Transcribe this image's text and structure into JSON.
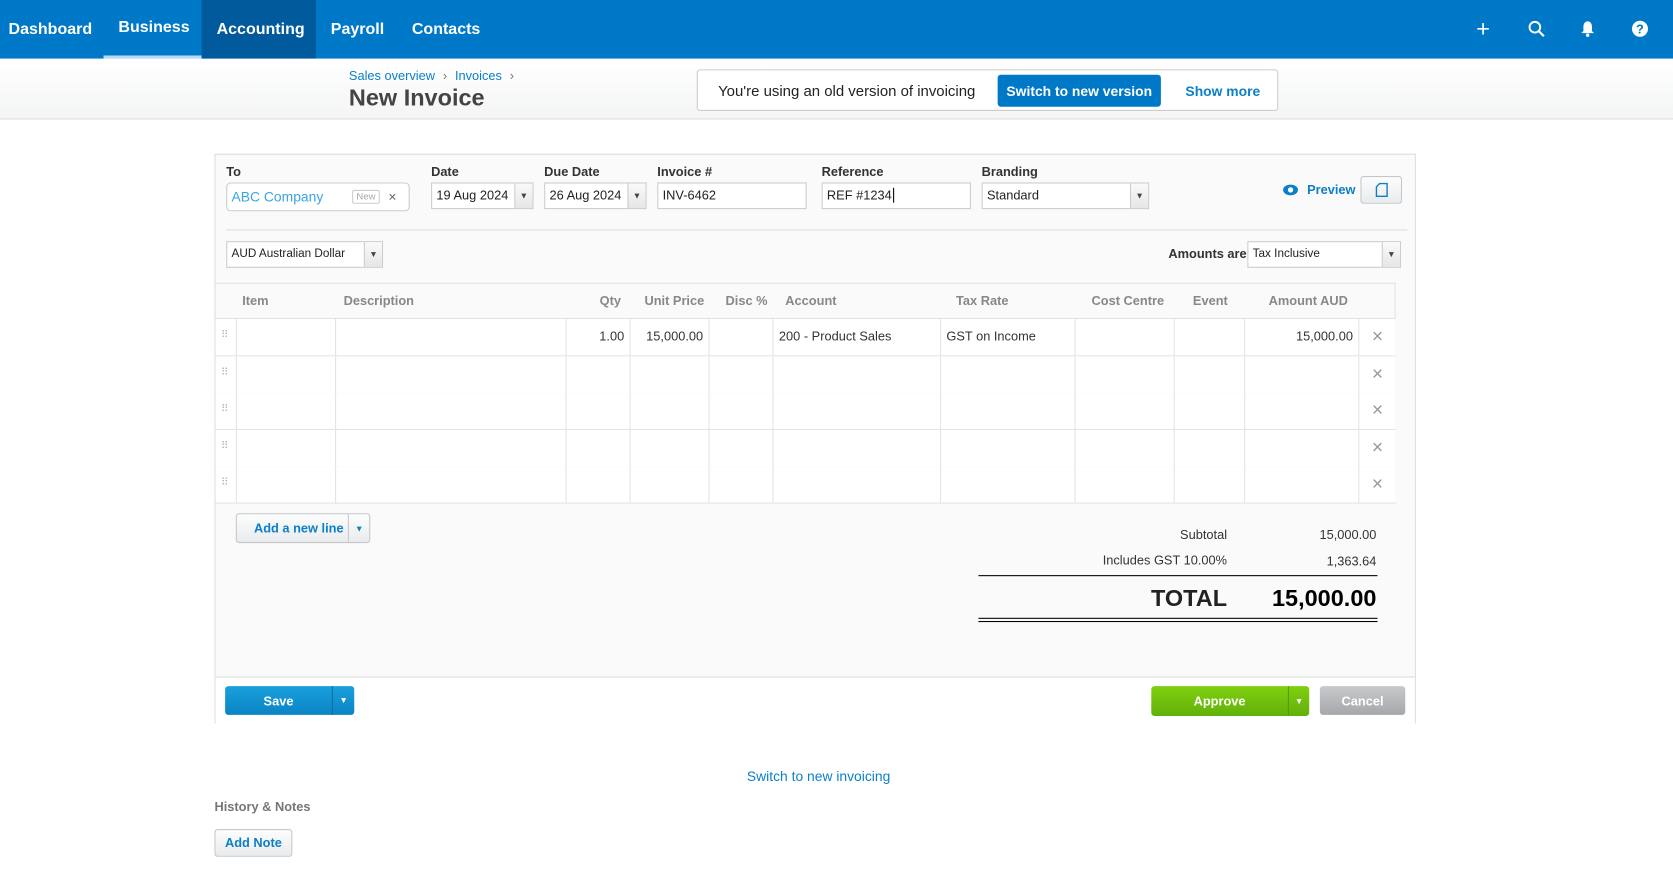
{
  "nav": {
    "tabs": [
      "Dashboard",
      "Business",
      "Accounting",
      "Payroll",
      "Contacts"
    ],
    "icons": [
      "plus-icon",
      "search-icon",
      "bell-icon",
      "help-icon"
    ]
  },
  "breadcrumb": [
    "Sales overview",
    "Invoices"
  ],
  "page_title": "New Invoice",
  "banner": {
    "text": "You're using an old version of invoicing",
    "switch_label": "Switch to new version",
    "more_label": "Show more"
  },
  "form": {
    "to_label": "To",
    "to_value": "ABC Company",
    "new_badge": "New",
    "date_label": "Date",
    "date_value": "19 Aug 2024",
    "due_label": "Due Date",
    "due_value": "26 Aug 2024",
    "invoice_label": "Invoice #",
    "invoice_value": "INV-6462",
    "reference_label": "Reference",
    "reference_value": "REF #1234",
    "branding_label": "Branding",
    "branding_value": "Standard",
    "preview_label": "Preview",
    "currency": "AUD Australian Dollar",
    "amounts_label": "Amounts are",
    "amounts_value": "Tax Inclusive"
  },
  "table": {
    "headers": [
      "Item",
      "Description",
      "Qty",
      "Unit Price",
      "Disc %",
      "Account",
      "Tax Rate",
      "Cost Centre",
      "Event",
      "Amount AUD"
    ],
    "rows": [
      [
        "",
        "",
        "1.00",
        "15,000.00",
        "",
        "200 - Product Sales",
        "GST on Income",
        "",
        "",
        "15,000.00"
      ],
      [
        "",
        "",
        "",
        "",
        "",
        "",
        "",
        "",
        "",
        ""
      ],
      [
        "",
        "",
        "",
        "",
        "",
        "",
        "",
        "",
        "",
        ""
      ],
      [
        "",
        "",
        "",
        "",
        "",
        "",
        "",
        "",
        "",
        ""
      ],
      [
        "",
        "",
        "",
        "",
        "",
        "",
        "",
        "",
        "",
        ""
      ]
    ]
  },
  "add_line_label": "Add a new line",
  "totals": {
    "subtotal_label": "Subtotal",
    "subtotal": "15,000.00",
    "gst_label": "Includes GST 10.00%",
    "gst": "1,363.64",
    "total_label": "TOTAL",
    "total": "15,000.00"
  },
  "actions": {
    "save": "Save",
    "approve": "Approve",
    "cancel": "Cancel"
  },
  "switch_link": "Switch to new invoicing",
  "history_label": "History & Notes",
  "add_note": "Add Note",
  "colors": {
    "nav": "#0078c8",
    "accent": "#0b7fc7",
    "approve": "#6cbf0a"
  }
}
